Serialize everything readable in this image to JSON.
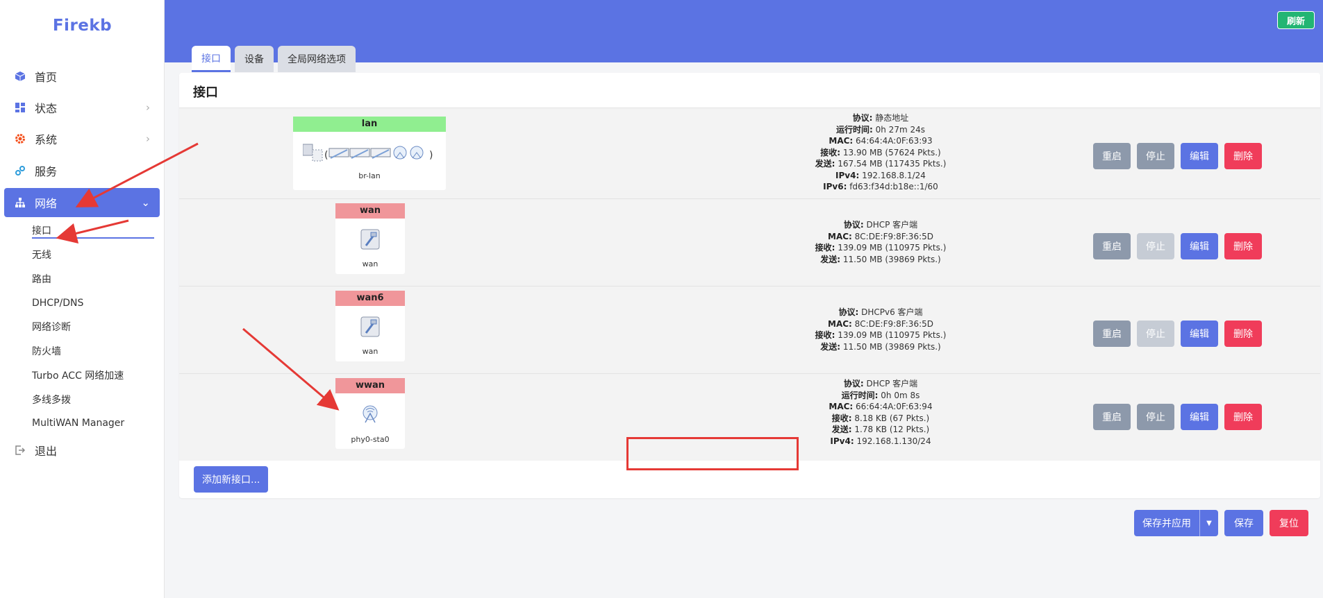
{
  "brand": "Firekb",
  "sidebar": {
    "items": [
      {
        "label": "首页",
        "icon": "cube-icon"
      },
      {
        "label": "状态",
        "icon": "dashboard-icon"
      },
      {
        "label": "系统",
        "icon": "gear-icon"
      },
      {
        "label": "服务",
        "icon": "services-icon"
      },
      {
        "label": "网络",
        "icon": "network-icon"
      }
    ],
    "network_sub": [
      "接口",
      "无线",
      "路由",
      "DHCP/DNS",
      "网络诊断",
      "防火墙",
      "Turbo ACC 网络加速",
      "多线多拨",
      "MultiWAN Manager"
    ],
    "logout": "退出"
  },
  "header": {
    "refresh_label": "刷新",
    "tabs": [
      "接口",
      "设备",
      "全局网络选项"
    ]
  },
  "section_title": "接口",
  "interfaces": [
    {
      "name": "lan",
      "device": "br-lan",
      "info": [
        {
          "k": "协议:",
          "v": " 静态地址"
        },
        {
          "k": "运行时间:",
          "v": " 0h 27m 24s"
        },
        {
          "k": "MAC:",
          "v": " 64:64:4A:0F:63:93"
        },
        {
          "k": "接收:",
          "v": " 13.90 MB (57624 Pkts.)"
        },
        {
          "k": "发送:",
          "v": " 167.54 MB (117435 Pkts.)"
        },
        {
          "k": "IPv4:",
          "v": " 192.168.8.1/24"
        },
        {
          "k": "IPv6:",
          "v": " fd63:f34d:b18e::1/60"
        }
      ],
      "stop_disabled": false
    },
    {
      "name": "wan",
      "device": "wan",
      "info": [
        {
          "k": "协议:",
          "v": " DHCP 客户端"
        },
        {
          "k": "MAC:",
          "v": " 8C:DE:F9:8F:36:5D"
        },
        {
          "k": "接收:",
          "v": " 139.09 MB (110975 Pkts.)"
        },
        {
          "k": "发送:",
          "v": " 11.50 MB (39869 Pkts.)"
        }
      ],
      "stop_disabled": true
    },
    {
      "name": "wan6",
      "device": "wan",
      "info": [
        {
          "k": "协议:",
          "v": " DHCPv6 客户端"
        },
        {
          "k": "MAC:",
          "v": " 8C:DE:F9:8F:36:5D"
        },
        {
          "k": "接收:",
          "v": " 139.09 MB (110975 Pkts.)"
        },
        {
          "k": "发送:",
          "v": " 11.50 MB (39869 Pkts.)"
        }
      ],
      "stop_disabled": true
    },
    {
      "name": "wwan",
      "device": "phy0-sta0",
      "info": [
        {
          "k": "协议:",
          "v": " DHCP 客户端"
        },
        {
          "k": "运行时间:",
          "v": " 0h 0m 8s"
        },
        {
          "k": "MAC:",
          "v": " 66:64:4A:0F:63:94"
        },
        {
          "k": "接收:",
          "v": " 8.18 KB (67 Pkts.)"
        },
        {
          "k": "发送:",
          "v": " 1.78 KB (12 Pkts.)"
        },
        {
          "k": "IPv4:",
          "v": " 192.168.1.130/24"
        }
      ],
      "stop_disabled": false
    }
  ],
  "row_actions": {
    "restart": "重启",
    "stop": "停止",
    "edit": "编辑",
    "delete": "删除"
  },
  "add_interface_label": "添加新接口...",
  "footer": {
    "save_apply": "保存并应用",
    "save": "保存",
    "reset": "复位"
  },
  "colors": {
    "accent": "#5b73e3",
    "danger": "#f03c5a",
    "success": "#22b573",
    "muted": "#8d99ab"
  }
}
